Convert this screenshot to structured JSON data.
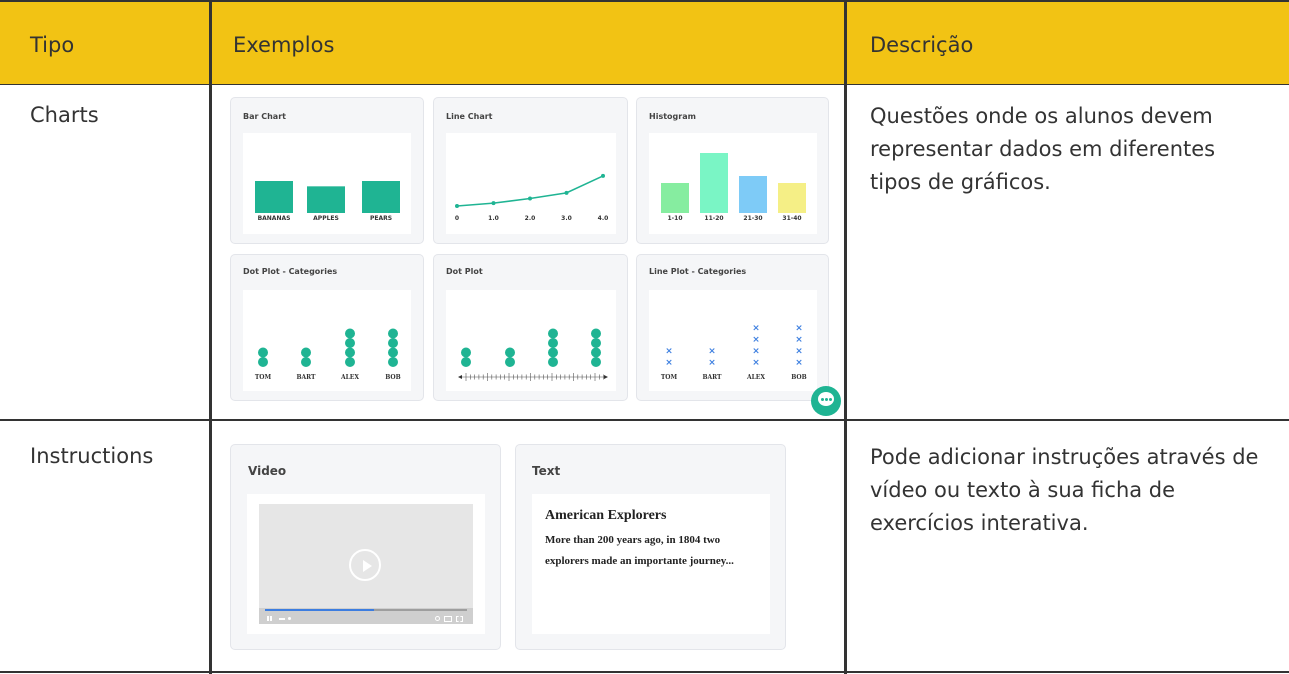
{
  "header": {
    "col1": "Tipo",
    "col2": "Exemplos",
    "col3": "Descrição"
  },
  "rows": [
    {
      "label": "Charts",
      "description": "Questões onde os alunos devem representar dados em diferentes tipos de gráficos.",
      "cards": [
        {
          "title": "Bar Chart",
          "categories": [
            "BANANAS",
            "APPLES",
            "PEARS"
          ],
          "values": [
            3,
            2.5,
            3
          ],
          "color": "#1fb493"
        },
        {
          "title": "Line Chart",
          "x": [
            0,
            1.0,
            2.0,
            3.0,
            4.0
          ],
          "x_labels": [
            "0",
            "1.0",
            "2.0",
            "3.0",
            "4.0"
          ],
          "y": [
            1,
            1.3,
            1.8,
            2.4,
            4.2
          ],
          "color": "#1fb493"
        },
        {
          "title": "Histogram",
          "categories": [
            "1-10",
            "11-20",
            "21-30",
            "31-40"
          ],
          "values": [
            3,
            6,
            3.7,
            3
          ],
          "colors": [
            "#86eda0",
            "#7af5c5",
            "#7ecbf7",
            "#f5ef86"
          ]
        },
        {
          "title": "Dot Plot - Categories",
          "categories": [
            "TOM",
            "BART",
            "ALEX",
            "BOB"
          ],
          "counts": [
            2,
            2,
            4,
            4
          ],
          "color": "#1fb493"
        },
        {
          "title": "Dot Plot",
          "counts": [
            2,
            2,
            4,
            4
          ],
          "color": "#1fb493"
        },
        {
          "title": "Line Plot - Categories",
          "categories": [
            "TOM",
            "BART",
            "ALEX",
            "BOB"
          ],
          "counts": [
            2,
            2,
            4,
            4
          ],
          "mark": "×",
          "color": "#3d7fe0"
        }
      ]
    },
    {
      "label": "Instructions",
      "description": "Pode adicionar instruções através de vídeo ou texto à sua ficha de exercícios interativa.",
      "video_card": {
        "title": "Video",
        "progress": 0.54
      },
      "text_card": {
        "title": "Text",
        "heading": "American Explorers",
        "body": "More than 200 years ago, in 1804 two explorers made an importante journey..."
      }
    }
  ],
  "colors": {
    "header_bg": "#f2c314",
    "chart_green": "#1fb493",
    "line_plot_blue": "#3d7fe0",
    "chat_bubble": "#1fb493"
  },
  "icons": {
    "chat": "chat-bubble-icon",
    "play": "play-icon"
  }
}
